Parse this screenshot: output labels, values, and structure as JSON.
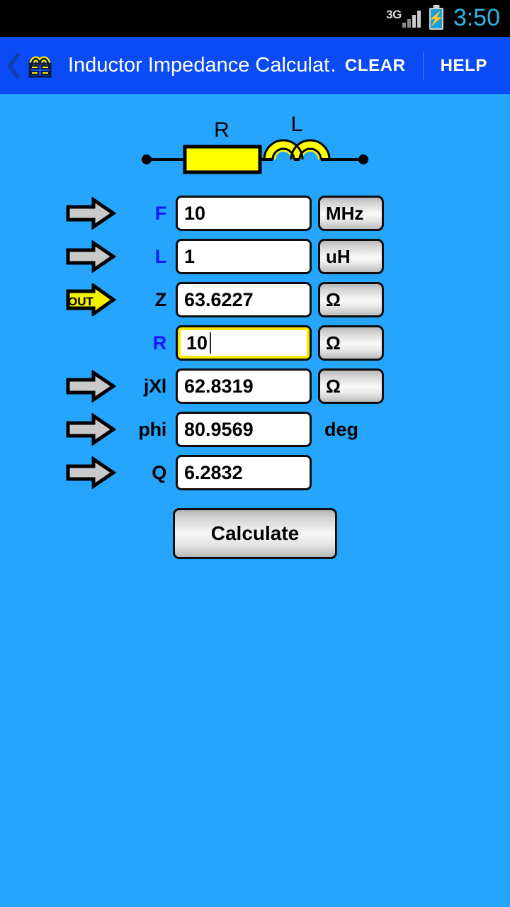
{
  "status_bar": {
    "network_label": "3G",
    "signal_icon": "signal-bars-icon",
    "battery_icon": "battery-charging-icon",
    "clock": "3:50",
    "clock_color": "#33b5e5"
  },
  "action_bar": {
    "up_icon": "back-caret-icon",
    "app_icon": "inductor-app-icon",
    "title": "Inductor Impedance Calculat…",
    "clear_label": "CLEAR",
    "help_label": "HELP",
    "background_color": "#0b4bf5"
  },
  "page": {
    "background_color": "#26a5fc"
  },
  "circuit": {
    "resistor_label": "R",
    "inductor_label": "L",
    "resistor_color": "#ffff00",
    "inductor_color": "#ffff00",
    "wire_color": "#000000"
  },
  "rows": [
    {
      "arrow": "in-arrow-icon",
      "arrow_type": "in",
      "label": "F",
      "label_kind": "input",
      "value": "10",
      "focused": false,
      "unit": "MHz",
      "unit_kind": "button"
    },
    {
      "arrow": "in-arrow-icon",
      "arrow_type": "in",
      "label": "L",
      "label_kind": "input",
      "value": "1",
      "focused": false,
      "unit": "uH",
      "unit_kind": "button"
    },
    {
      "arrow": "out-arrow-icon",
      "arrow_type": "out",
      "arrow_text": "OUT",
      "label": "Z",
      "label_kind": "output",
      "value": "63.6227",
      "focused": false,
      "unit": "Ω",
      "unit_kind": "button"
    },
    {
      "arrow": "none",
      "arrow_type": "none",
      "label": "R",
      "label_kind": "input",
      "value": "10",
      "focused": true,
      "unit": "Ω",
      "unit_kind": "button"
    },
    {
      "arrow": "in-arrow-icon",
      "arrow_type": "in",
      "label": "jXl",
      "label_kind": "output",
      "value": "62.8319",
      "focused": false,
      "unit": "Ω",
      "unit_kind": "button"
    },
    {
      "arrow": "in-arrow-icon",
      "arrow_type": "in",
      "label": "phi",
      "label_kind": "output",
      "value": "80.9569",
      "focused": false,
      "unit": "deg",
      "unit_kind": "text"
    },
    {
      "arrow": "in-arrow-icon",
      "arrow_type": "in",
      "label": "Q",
      "label_kind": "output",
      "value": "6.2832",
      "focused": false,
      "unit": "",
      "unit_kind": "none"
    }
  ],
  "calculate": {
    "label": "Calculate"
  }
}
